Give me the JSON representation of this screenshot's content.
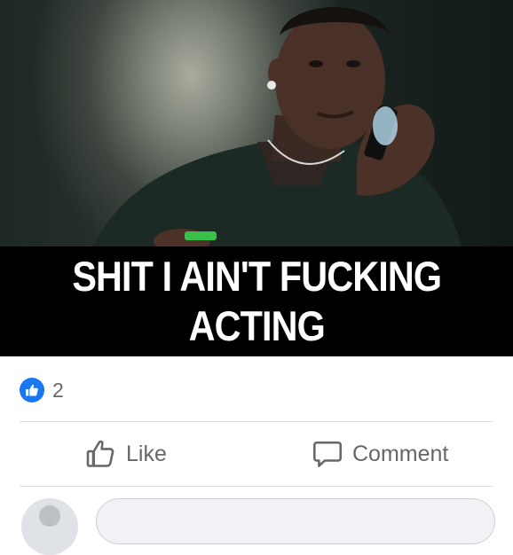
{
  "post": {
    "meme_caption": "SHIT I AIN'T FUCKING\nACTING",
    "reaction_count": "2",
    "actions": {
      "like_label": "Like",
      "comment_label": "Comment"
    }
  },
  "colors": {
    "like_blue": "#1877f2",
    "action_gray": "#65676b",
    "divider": "#dadde1"
  },
  "icons": {
    "reaction": "thumbs-up-icon",
    "like": "thumbs-up-outline-icon",
    "comment": "speech-bubble-icon"
  }
}
